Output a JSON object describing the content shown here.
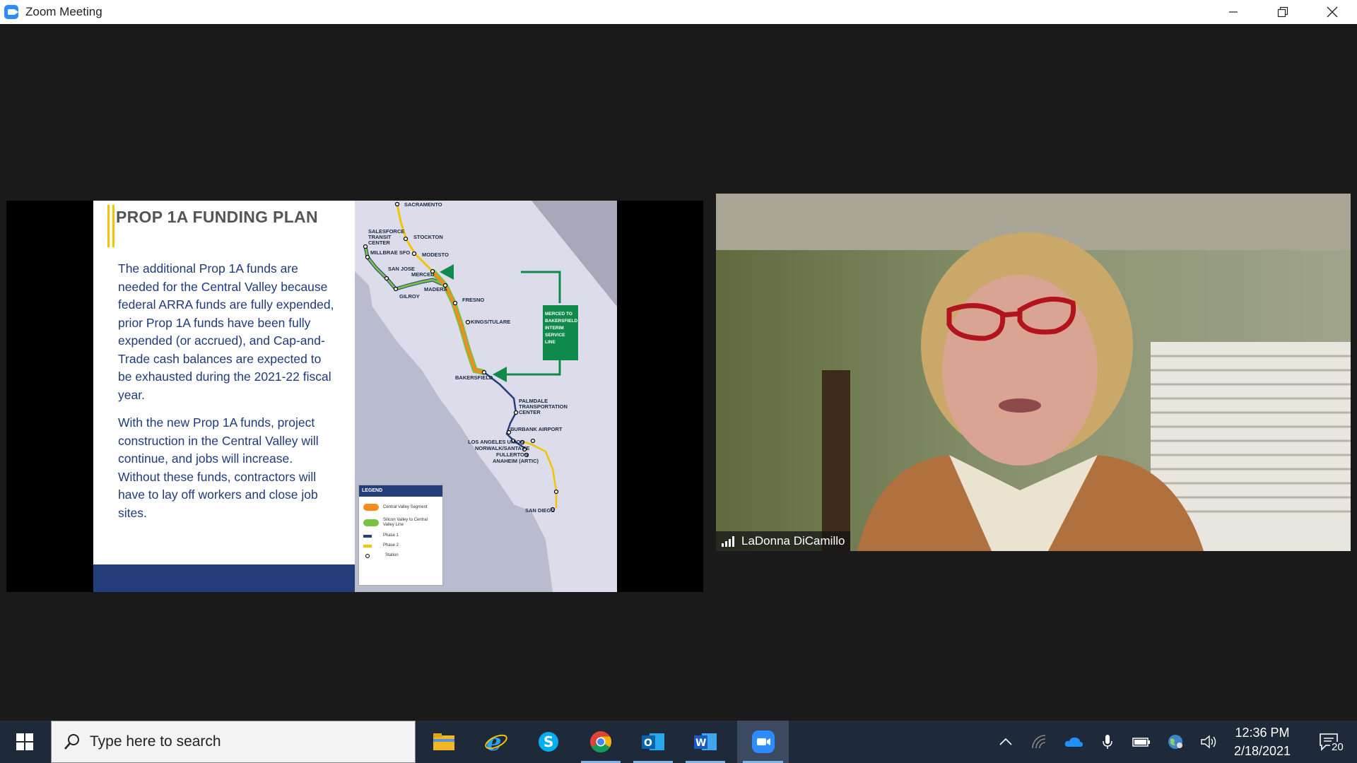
{
  "window": {
    "title": "Zoom Meeting"
  },
  "slide": {
    "title": "PROP 1A FUNDING PLAN",
    "paragraph1": "The additional Prop 1A funds are needed for the Central Valley because federal ARRA funds are fully expended, prior Prop 1A funds have been fully expended (or accrued), and Cap-and-Trade cash balances are expected to be exhausted during the 2021-22 fiscal year.",
    "paragraph2": "With the new Prop 1A funds, project construction in the Central Valley will continue, and jobs will increase. Without these funds, contractors will have to lay off workers and close job sites.",
    "map": {
      "cities": {
        "sacramento": "SACRAMENTO",
        "salesforce": "SALESFORCE TRANSIT CENTER",
        "stockton": "STOCKTON",
        "millbrae": "MILLBRAE SFO",
        "modesto": "MODESTO",
        "san_jose": "SAN JOSE",
        "merced": "MERCED",
        "gilroy": "GILROY",
        "madera": "MADERA",
        "fresno": "FRESNO",
        "kings_tulare": "KINGS/TULARE",
        "bakersfield": "BAKERSFIELD",
        "palmdale": "PALMDALE TRANSPORTATION CENTER",
        "burbank": "BURBANK AIRPORT",
        "los_angeles": "LOS ANGELES UNION",
        "norwalk": "NORWALK/SANTA FE",
        "fullerton": "FULLERTON",
        "anaheim": "ANAHEIM (ARTIC)",
        "san_diego": "SAN DIEGO"
      },
      "callout": "MERCED TO BAKERSFIELD INTERIM SERVICE LINE",
      "legend": {
        "title": "LEGEND",
        "items": [
          {
            "label": "Central Valley Segment",
            "color": "#f58a1f"
          },
          {
            "label": "Silicon Valley to Central Valley Line",
            "color": "#7ac143"
          },
          {
            "label": "Phase 1",
            "color": "#243e7c"
          },
          {
            "label": "Phase 2",
            "color": "#f2c500"
          },
          {
            "label": "Station",
            "color": "#000000"
          }
        ]
      }
    }
  },
  "participant": {
    "name": "LaDonna DiCamillo"
  },
  "taskbar": {
    "search_placeholder": "Type here to search",
    "time": "12:36 PM",
    "date": "2/18/2021",
    "notification_count": "20"
  }
}
